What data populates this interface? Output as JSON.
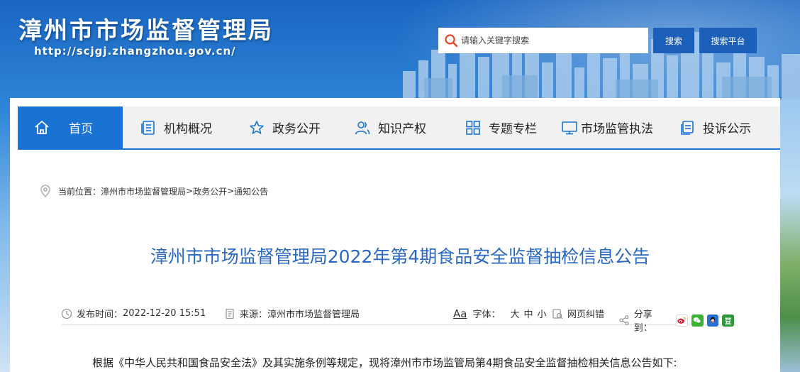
{
  "header": {
    "site_title": "漳州市市场监督管理局",
    "site_url": "http://scjgj.zhangzhou.gov.cn/"
  },
  "search": {
    "placeholder": "请输入关键字搜索",
    "search_button": "搜索",
    "platform_button": "搜索平台"
  },
  "nav": {
    "items": [
      {
        "label": "首页",
        "icon": "home-icon",
        "active": true
      },
      {
        "label": "机构概况",
        "icon": "document-list-icon"
      },
      {
        "label": "政务公开",
        "icon": "star-icon"
      },
      {
        "label": "知识产权",
        "icon": "users-icon"
      },
      {
        "label": "专题专栏",
        "icon": "grid-icon"
      },
      {
        "label": "市场监管执法",
        "icon": "monitor-icon"
      },
      {
        "label": "投诉公示",
        "icon": "copy-doc-icon"
      }
    ]
  },
  "breadcrumb": {
    "prefix": "当前位置：",
    "items": [
      "漳州市市场监督管理局",
      "政务公开",
      "通知公告"
    ],
    "separator": ">"
  },
  "article": {
    "title": "漳州市市场监督管理局2022年第4期食品安全监督抽检信息公告",
    "meta": {
      "publish_label": "发布时间：",
      "publish_time": "2022-12-20 15:51",
      "source_label": "来源：",
      "source": "漳州市市场监督管理局",
      "font_icon_text": "Aa",
      "font_label": "字体：",
      "font_sizes": [
        "大",
        "中",
        "小"
      ],
      "correction": "网页纠错",
      "share_label": "分享到："
    },
    "first_paragraph": "根据《中华人民共和国食品安全法》及其实施条例等规定，现将漳州市市场监管局第4期食品安全监督抽检相关信息公告如下:"
  },
  "colors": {
    "nav_active": "#1a73d2",
    "title": "#2a68c2",
    "button": "#1c5fb8",
    "search_icon": "#e8452c"
  },
  "share": [
    "weibo-icon",
    "wechat-icon",
    "qq-icon",
    "douban-icon"
  ]
}
